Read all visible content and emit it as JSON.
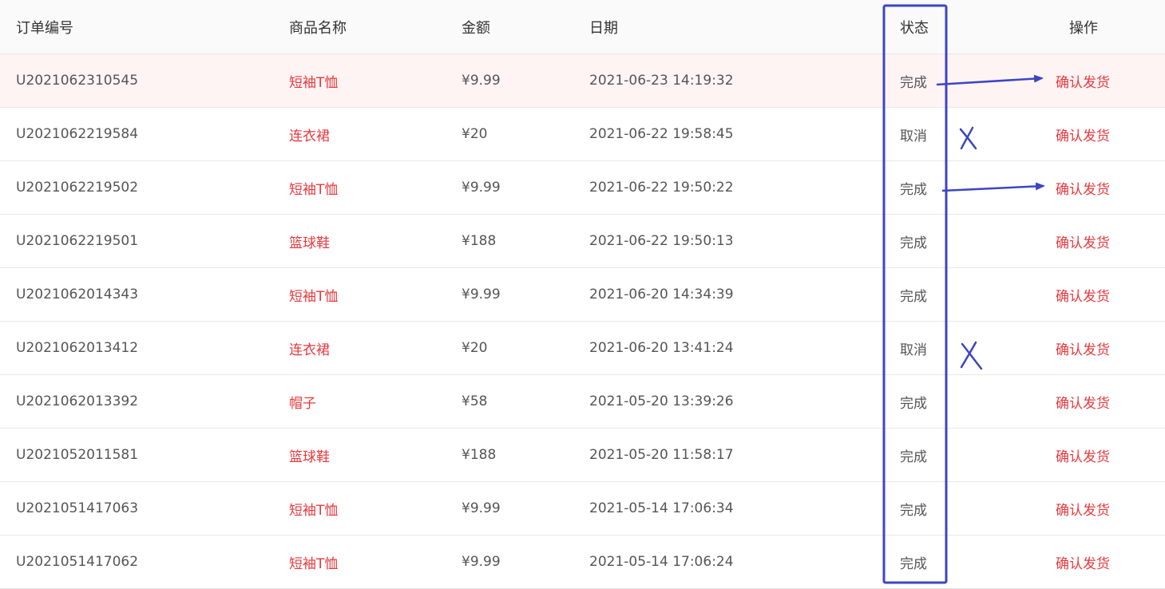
{
  "headers": {
    "order_id": "订单编号",
    "product": "商品名称",
    "amount": "金额",
    "date": "日期",
    "status": "状态",
    "action": "操作"
  },
  "rows": [
    {
      "order_id": "U2021062310545",
      "product": "短袖T恤",
      "amount": "¥9.99",
      "date": "2021-06-23 14:19:32",
      "status": "完成",
      "action": "确认发货"
    },
    {
      "order_id": "U2021062219584",
      "product": "连衣裙",
      "amount": "¥20",
      "date": "2021-06-22 19:58:45",
      "status": "取消",
      "action": "确认发货"
    },
    {
      "order_id": "U2021062219502",
      "product": "短袖T恤",
      "amount": "¥9.99",
      "date": "2021-06-22 19:50:22",
      "status": "完成",
      "action": "确认发货"
    },
    {
      "order_id": "U2021062219501",
      "product": "篮球鞋",
      "amount": "¥188",
      "date": "2021-06-22 19:50:13",
      "status": "完成",
      "action": "确认发货"
    },
    {
      "order_id": "U2021062014343",
      "product": "短袖T恤",
      "amount": "¥9.99",
      "date": "2021-06-20 14:34:39",
      "status": "完成",
      "action": "确认发货"
    },
    {
      "order_id": "U2021062013412",
      "product": "连衣裙",
      "amount": "¥20",
      "date": "2021-06-20 13:41:24",
      "status": "取消",
      "action": "确认发货"
    },
    {
      "order_id": "U2021062013392",
      "product": "帽子",
      "amount": "¥58",
      "date": "2021-05-20 13:39:26",
      "status": "完成",
      "action": "确认发货"
    },
    {
      "order_id": "U2021052011581",
      "product": "篮球鞋",
      "amount": "¥188",
      "date": "2021-05-20 11:58:17",
      "status": "完成",
      "action": "确认发货"
    },
    {
      "order_id": "U2021051417063",
      "product": "短袖T恤",
      "amount": "¥9.99",
      "date": "2021-05-14 17:06:34",
      "status": "完成",
      "action": "确认发货"
    },
    {
      "order_id": "U2021051417062",
      "product": "短袖T恤",
      "amount": "¥9.99",
      "date": "2021-05-14 17:06:24",
      "status": "完成",
      "action": "确认发货"
    }
  ],
  "colors": {
    "link": "#e8383d",
    "text": "#555555",
    "header_bg": "#fafafa",
    "highlight_row_bg": "#fff4f4",
    "annotation": "#3d45c4"
  }
}
